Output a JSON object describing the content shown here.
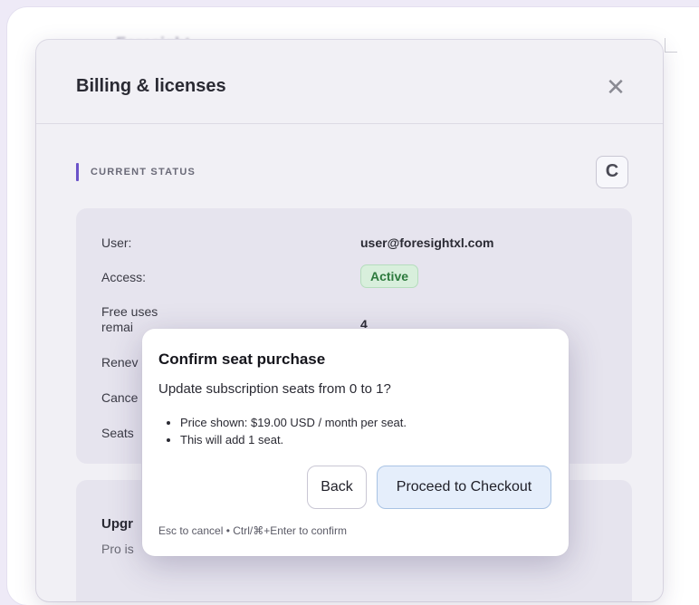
{
  "background": {
    "faded_heading": "Foresight..."
  },
  "panel": {
    "title": "Billing & licenses",
    "close_label": "✕",
    "section_label": "CURRENT STATUS",
    "refresh_label": "C",
    "rows": [
      {
        "label": "User:",
        "value": "user@foresightxl.com"
      },
      {
        "label": "Access:",
        "value": "Active"
      },
      {
        "label": "Free uses remai",
        "value": "4"
      },
      {
        "label": "Renev",
        "value": ""
      },
      {
        "label": "Cance",
        "value": ""
      },
      {
        "label": "Seats",
        "value": ""
      }
    ],
    "upgrade_title": "Upgr",
    "upgrade_text": "Pro is"
  },
  "dialog": {
    "title": "Confirm seat purchase",
    "message": "Update subscription seats from 0 to 1?",
    "bullets": [
      "Price shown: $19.00 USD / month per seat.",
      "This will add 1 seat."
    ],
    "back_label": "Back",
    "proceed_label": "Proceed to Checkout",
    "hint": "Esc to cancel • Ctrl/⌘+Enter to confirm"
  },
  "colors": {
    "accent": "#6b53c9",
    "active_badge_bg": "#d8efdc",
    "active_badge_text": "#2d7a3d",
    "proceed_bg": "#e5eefb"
  }
}
